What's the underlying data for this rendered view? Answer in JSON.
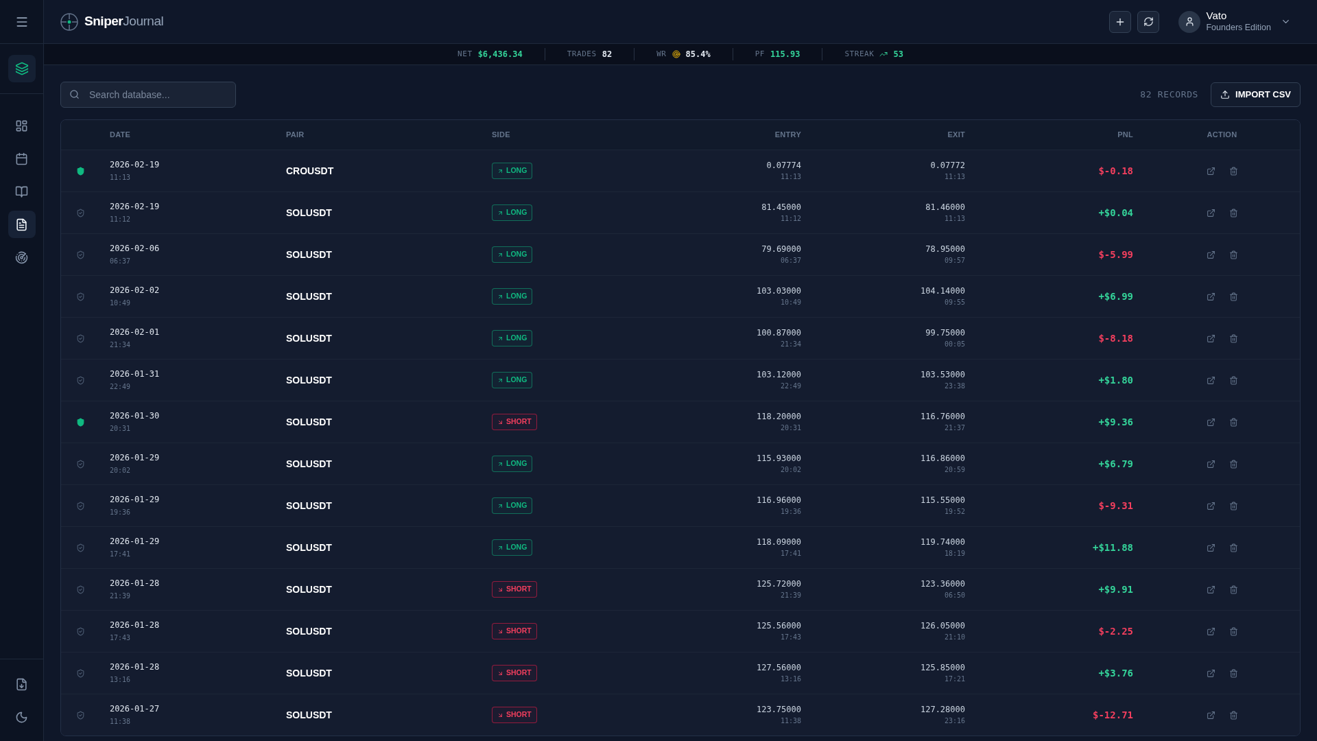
{
  "brand": {
    "primary": "Sniper",
    "secondary": "Journal"
  },
  "sidebar": {
    "items": [
      {
        "kind": "dashboard",
        "selected": false
      },
      {
        "kind": "calendar",
        "selected": false
      },
      {
        "kind": "journal",
        "selected": false
      },
      {
        "kind": "trades",
        "selected": true
      },
      {
        "kind": "radar",
        "selected": false
      }
    ]
  },
  "user": {
    "name": "Vato",
    "plan": "Founders Edition"
  },
  "stats": [
    {
      "label": "NET",
      "value": "$6,436.34",
      "kind": "gain"
    },
    {
      "label": "TRADES",
      "value": "82",
      "kind": "plain"
    },
    {
      "label": "WR",
      "value": "85.4%",
      "kind": "rate"
    },
    {
      "label": "PF",
      "value": "115.93",
      "kind": "gain"
    },
    {
      "label": "STREAK",
      "value": "53",
      "kind": "streak"
    }
  ],
  "search": {
    "placeholder": "Search database..."
  },
  "records": "82 RECORDS",
  "import_button": "IMPORT CSV",
  "table": {
    "columns": [
      "DATE",
      "PAIR",
      "SIDE",
      "ENTRY",
      "EXIT",
      "PNL",
      "ACTION"
    ],
    "rows": [
      {
        "marked": true,
        "date": "2026-02-19",
        "time": "11:13",
        "pair": "CROUSDT",
        "side": {
          "label": "LONG",
          "kind": "long"
        },
        "entry": {
          "price": "0.07774",
          "time": "11:13"
        },
        "exit": {
          "price": "0.07772",
          "time": "11:13"
        },
        "pnl": {
          "value": "$-0.18",
          "kind": "loss"
        }
      },
      {
        "marked": false,
        "date": "2026-02-19",
        "time": "11:12",
        "pair": "SOLUSDT",
        "side": {
          "label": "LONG",
          "kind": "long"
        },
        "entry": {
          "price": "81.45000",
          "time": "11:12"
        },
        "exit": {
          "price": "81.46000",
          "time": "11:13"
        },
        "pnl": {
          "value": "+$0.04",
          "kind": "gain"
        }
      },
      {
        "marked": false,
        "date": "2026-02-06",
        "time": "06:37",
        "pair": "SOLUSDT",
        "side": {
          "label": "LONG",
          "kind": "long"
        },
        "entry": {
          "price": "79.69000",
          "time": "06:37"
        },
        "exit": {
          "price": "78.95000",
          "time": "09:57"
        },
        "pnl": {
          "value": "$-5.99",
          "kind": "loss"
        }
      },
      {
        "marked": false,
        "date": "2026-02-02",
        "time": "10:49",
        "pair": "SOLUSDT",
        "side": {
          "label": "LONG",
          "kind": "long"
        },
        "entry": {
          "price": "103.03000",
          "time": "10:49"
        },
        "exit": {
          "price": "104.14000",
          "time": "09:55"
        },
        "pnl": {
          "value": "+$6.99",
          "kind": "gain"
        }
      },
      {
        "marked": false,
        "date": "2026-02-01",
        "time": "21:34",
        "pair": "SOLUSDT",
        "side": {
          "label": "LONG",
          "kind": "long"
        },
        "entry": {
          "price": "100.87000",
          "time": "21:34"
        },
        "exit": {
          "price": "99.75000",
          "time": "00:05"
        },
        "pnl": {
          "value": "$-8.18",
          "kind": "loss"
        }
      },
      {
        "marked": false,
        "date": "2026-01-31",
        "time": "22:49",
        "pair": "SOLUSDT",
        "side": {
          "label": "LONG",
          "kind": "long"
        },
        "entry": {
          "price": "103.12000",
          "time": "22:49"
        },
        "exit": {
          "price": "103.53000",
          "time": "23:38"
        },
        "pnl": {
          "value": "+$1.80",
          "kind": "gain"
        }
      },
      {
        "marked": true,
        "date": "2026-01-30",
        "time": "20:31",
        "pair": "SOLUSDT",
        "side": {
          "label": "SHORT",
          "kind": "short"
        },
        "entry": {
          "price": "118.20000",
          "time": "20:31"
        },
        "exit": {
          "price": "116.76000",
          "time": "21:37"
        },
        "pnl": {
          "value": "+$9.36",
          "kind": "gain"
        }
      },
      {
        "marked": false,
        "date": "2026-01-29",
        "time": "20:02",
        "pair": "SOLUSDT",
        "side": {
          "label": "LONG",
          "kind": "long"
        },
        "entry": {
          "price": "115.93000",
          "time": "20:02"
        },
        "exit": {
          "price": "116.86000",
          "time": "20:59"
        },
        "pnl": {
          "value": "+$6.79",
          "kind": "gain"
        }
      },
      {
        "marked": false,
        "date": "2026-01-29",
        "time": "19:36",
        "pair": "SOLUSDT",
        "side": {
          "label": "LONG",
          "kind": "long"
        },
        "entry": {
          "price": "116.96000",
          "time": "19:36"
        },
        "exit": {
          "price": "115.55000",
          "time": "19:52"
        },
        "pnl": {
          "value": "$-9.31",
          "kind": "loss"
        }
      },
      {
        "marked": false,
        "date": "2026-01-29",
        "time": "17:41",
        "pair": "SOLUSDT",
        "side": {
          "label": "LONG",
          "kind": "long"
        },
        "entry": {
          "price": "118.09000",
          "time": "17:41"
        },
        "exit": {
          "price": "119.74000",
          "time": "18:19"
        },
        "pnl": {
          "value": "+$11.88",
          "kind": "gain"
        }
      },
      {
        "marked": false,
        "date": "2026-01-28",
        "time": "21:39",
        "pair": "SOLUSDT",
        "side": {
          "label": "SHORT",
          "kind": "short"
        },
        "entry": {
          "price": "125.72000",
          "time": "21:39"
        },
        "exit": {
          "price": "123.36000",
          "time": "06:50"
        },
        "pnl": {
          "value": "+$9.91",
          "kind": "gain"
        }
      },
      {
        "marked": false,
        "date": "2026-01-28",
        "time": "17:43",
        "pair": "SOLUSDT",
        "side": {
          "label": "SHORT",
          "kind": "short"
        },
        "entry": {
          "price": "125.56000",
          "time": "17:43"
        },
        "exit": {
          "price": "126.05000",
          "time": "21:10"
        },
        "pnl": {
          "value": "$-2.25",
          "kind": "loss"
        }
      },
      {
        "marked": false,
        "date": "2026-01-28",
        "time": "13:16",
        "pair": "SOLUSDT",
        "side": {
          "label": "SHORT",
          "kind": "short"
        },
        "entry": {
          "price": "127.56000",
          "time": "13:16"
        },
        "exit": {
          "price": "125.85000",
          "time": "17:21"
        },
        "pnl": {
          "value": "+$3.76",
          "kind": "gain"
        }
      },
      {
        "marked": false,
        "date": "2026-01-27",
        "time": "11:38",
        "pair": "SOLUSDT",
        "side": {
          "label": "SHORT",
          "kind": "short"
        },
        "entry": {
          "price": "123.75000",
          "time": "11:38"
        },
        "exit": {
          "price": "127.28000",
          "time": "23:16"
        },
        "pnl": {
          "value": "$-12.71",
          "kind": "loss"
        }
      }
    ]
  }
}
